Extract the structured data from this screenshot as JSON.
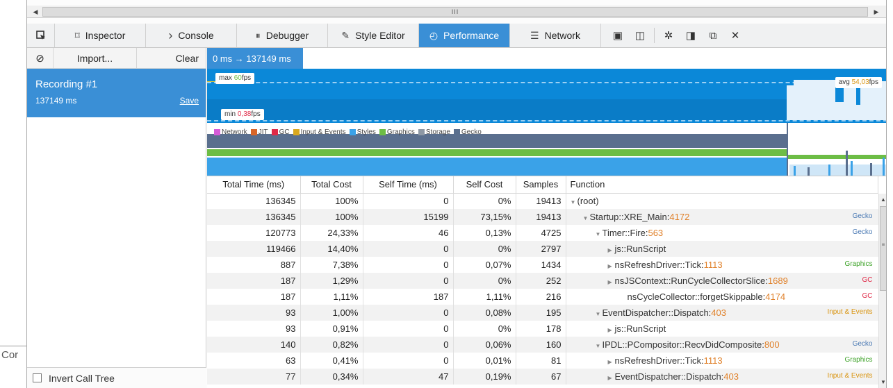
{
  "page_fragment": "Cor",
  "hscroll_grip": "III",
  "toolbar": {
    "tabs": [
      {
        "label": "Inspector",
        "icon": "inspector-icon",
        "selected": false
      },
      {
        "label": "Console",
        "icon": "console-icon",
        "selected": false
      },
      {
        "label": "Debugger",
        "icon": "debugger-icon",
        "selected": false
      },
      {
        "label": "Style Editor",
        "icon": "style-editor-icon",
        "selected": false
      },
      {
        "label": "Performance",
        "icon": "performance-icon",
        "selected": true
      },
      {
        "label": "Network",
        "icon": "network-icon",
        "selected": false
      }
    ]
  },
  "sidebar": {
    "import_label": "Import...",
    "clear_label": "Clear",
    "recording": {
      "title": "Recording #1",
      "duration": "137149 ms",
      "save_label": "Save"
    },
    "invert_label": "Invert Call Tree"
  },
  "range": {
    "label": "0 ms → 137149 ms"
  },
  "fps": {
    "max_prefix": "max",
    "max_value": "60",
    "max_unit": "fps",
    "min_prefix": "min",
    "min_value": "0,38",
    "min_unit": "fps",
    "avg_prefix": "avg",
    "avg_value": "54,03",
    "avg_unit": "fps",
    "colors": {
      "max": "#6dbd45",
      "min": "#e02a48",
      "avg": "#d9940f"
    }
  },
  "legend": [
    {
      "label": "Network",
      "color": "#d65bd8"
    },
    {
      "label": "JIT",
      "color": "#d96629"
    },
    {
      "label": "GC",
      "color": "#e02a48"
    },
    {
      "label": "Input & Events",
      "color": "#d9a81f"
    },
    {
      "label": "Styles",
      "color": "#3aa2e8"
    },
    {
      "label": "Graphics",
      "color": "#6dbd45"
    },
    {
      "label": "Storage",
      "color": "#8d98a5"
    },
    {
      "label": "Gecko",
      "color": "#5a6f8e"
    }
  ],
  "table": {
    "headers": [
      "Total Time (ms)",
      "Total Cost",
      "Self Time (ms)",
      "Self Cost",
      "Samples",
      "Function"
    ],
    "rows": [
      {
        "total": "136345",
        "cost": "100%",
        "self": "0",
        "selfcost": "0%",
        "samples": "19413",
        "twisty": "open",
        "fn": "(root)",
        "line": "",
        "cat": "",
        "catclass": ""
      },
      {
        "total": "136345",
        "cost": "100%",
        "self": "15199",
        "selfcost": "73,15%",
        "samples": "19413",
        "twisty": "open",
        "fn": "Startup::XRE_Main:",
        "line": "4172",
        "cat": "Gecko",
        "catclass": "cat-gecko"
      },
      {
        "total": "120773",
        "cost": "24,33%",
        "self": "46",
        "selfcost": "0,13%",
        "samples": "4725",
        "twisty": "open",
        "fn": "Timer::Fire:",
        "line": "563",
        "cat": "Gecko",
        "catclass": "cat-gecko"
      },
      {
        "total": "119466",
        "cost": "14,40%",
        "self": "0",
        "selfcost": "0%",
        "samples": "2797",
        "twisty": "closed",
        "fn": "js::RunScript",
        "line": "",
        "cat": "",
        "catclass": ""
      },
      {
        "total": "887",
        "cost": "7,38%",
        "self": "0",
        "selfcost": "0,07%",
        "samples": "1434",
        "twisty": "closed",
        "fn": "nsRefreshDriver::Tick:",
        "line": "1113",
        "cat": "Graphics",
        "catclass": "cat-graphics"
      },
      {
        "total": "187",
        "cost": "1,29%",
        "self": "0",
        "selfcost": "0%",
        "samples": "252",
        "twisty": "closed",
        "fn": "nsJSContext::RunCycleCollectorSlice:",
        "line": "1689",
        "cat": "GC",
        "catclass": "cat-gc"
      },
      {
        "total": "187",
        "cost": "1,11%",
        "self": "187",
        "selfcost": "1,11%",
        "samples": "216",
        "twisty": "none",
        "fn": "nsCycleCollector::forgetSkippable:",
        "line": "4174",
        "cat": "GC",
        "catclass": "cat-gc"
      },
      {
        "total": "93",
        "cost": "1,00%",
        "self": "0",
        "selfcost": "0,08%",
        "samples": "195",
        "twisty": "open",
        "fn": "EventDispatcher::Dispatch:",
        "line": "403",
        "cat": "Input & Events",
        "catclass": "cat-input"
      },
      {
        "total": "93",
        "cost": "0,91%",
        "self": "0",
        "selfcost": "0%",
        "samples": "178",
        "twisty": "closed",
        "fn": "js::RunScript",
        "line": "",
        "cat": "",
        "catclass": ""
      },
      {
        "total": "140",
        "cost": "0,82%",
        "self": "0",
        "selfcost": "0,06%",
        "samples": "160",
        "twisty": "open",
        "fn": "IPDL::PCompositor::RecvDidComposite:",
        "line": "800",
        "cat": "Gecko",
        "catclass": "cat-gecko"
      },
      {
        "total": "63",
        "cost": "0,41%",
        "self": "0",
        "selfcost": "0,01%",
        "samples": "81",
        "twisty": "closed",
        "fn": "nsRefreshDriver::Tick:",
        "line": "1113",
        "cat": "Graphics",
        "catclass": "cat-graphics"
      },
      {
        "total": "77",
        "cost": "0,34%",
        "self": "47",
        "selfcost": "0,19%",
        "samples": "67",
        "twisty": "closed",
        "fn": "EventDispatcher::Dispatch:",
        "line": "403",
        "cat": "Input & Events",
        "catclass": "cat-input"
      }
    ]
  }
}
